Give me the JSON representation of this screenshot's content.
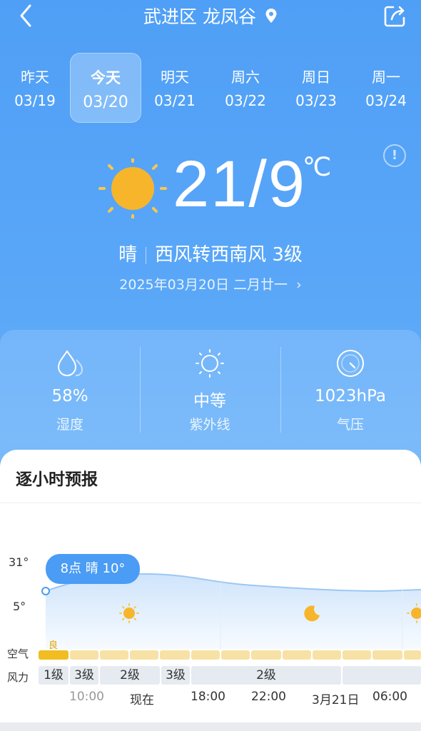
{
  "header": {
    "title": "武进区 龙凤谷"
  },
  "days": [
    {
      "name": "昨天",
      "date": "03/19"
    },
    {
      "name": "今天",
      "date": "03/20"
    },
    {
      "name": "明天",
      "date": "03/21"
    },
    {
      "name": "周六",
      "date": "03/22"
    },
    {
      "name": "周日",
      "date": "03/23"
    },
    {
      "name": "周一",
      "date": "03/24"
    }
  ],
  "current": {
    "temp": "21/9",
    "unit": "℃",
    "condition": "晴",
    "wind": "西风转西南风 3级",
    "date": "2025年03月20日 二月廿一"
  },
  "metrics": [
    {
      "value": "58%",
      "label": "湿度",
      "icon": "humidity-icon"
    },
    {
      "value": "中等",
      "label": "紫外线",
      "icon": "sun-icon"
    },
    {
      "value": "1023hPa",
      "label": "气压",
      "icon": "gauge-icon"
    }
  ],
  "hourly": {
    "title": "逐小时预报",
    "y_top": "31°",
    "y_bottom": "5°",
    "tooltip": "8点 晴 10°",
    "air_label": "空气",
    "air_quality": "良",
    "wind_label": "风力",
    "wind": [
      "1级",
      "3级",
      "2级",
      "3级",
      "2级"
    ],
    "times": [
      "10:00",
      "现在",
      "18:00",
      "22:00",
      "3月21日",
      "06:00"
    ]
  },
  "colors": {
    "accent": "#4a9cf4",
    "sun": "#f7b52c",
    "aqi_good": "#f1bd21"
  }
}
